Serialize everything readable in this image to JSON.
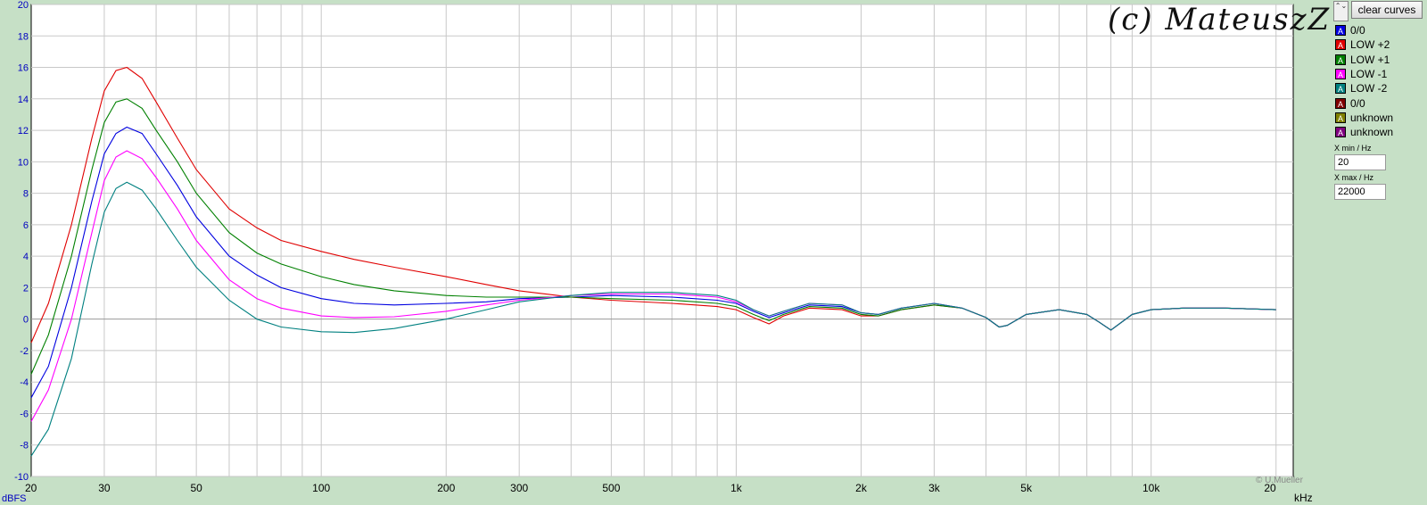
{
  "watermark": "(c) MateuszZ",
  "credit": "© U.Mueller",
  "controls": {
    "clear_label": "clear curves",
    "scroll_glyph": "⌃⌄",
    "xmin_label": "X min / Hz",
    "xmin_value": "20",
    "xmax_label": "X max / Hz",
    "xmax_value": "22000"
  },
  "colors": {
    "background": "#c6e0c6",
    "plot_bg": "#ffffff",
    "grid": "#c8c8c8",
    "axis_text": "#0000c0"
  },
  "chart_data": {
    "type": "line",
    "x_scale": "log",
    "xlim": [
      20,
      22000
    ],
    "ylim": [
      -10,
      20
    ],
    "ylabel_unit": "dBFS",
    "xunit": "kHz",
    "x_ticks": [
      20,
      30,
      50,
      100,
      200,
      300,
      500,
      1000,
      2000,
      3000,
      5000,
      10000,
      20000
    ],
    "x_tick_labels": [
      "20",
      "30",
      "50",
      "100",
      "200",
      "300",
      "500",
      "1k",
      "2k",
      "3k",
      "5k",
      "10k",
      "20"
    ],
    "y_ticks": [
      20,
      18,
      16,
      14,
      12,
      10,
      8,
      6,
      4,
      2,
      0,
      -2,
      -4,
      -6,
      -8,
      -10
    ],
    "y_tick_labels": [
      "20",
      "18",
      "16",
      "14",
      "12",
      "10",
      "8",
      "6",
      "4",
      "2",
      "0",
      "-2",
      "-4",
      "-6",
      "-8",
      "-10"
    ],
    "grid": true,
    "legend": [
      {
        "label": "0/0",
        "color": "#0000e0"
      },
      {
        "label": "LOW +2",
        "color": "#e00000"
      },
      {
        "label": "LOW +1",
        "color": "#008000"
      },
      {
        "label": "LOW -1",
        "color": "#ff00ff"
      },
      {
        "label": "LOW -2",
        "color": "#008080"
      },
      {
        "label": "0/0",
        "color": "#800000"
      },
      {
        "label": "unknown",
        "color": "#808000"
      },
      {
        "label": "unknown",
        "color": "#800080"
      }
    ],
    "series": [
      {
        "name": "0/0",
        "color": "#0000e0",
        "x": [
          20,
          22,
          25,
          28,
          30,
          32,
          34,
          37,
          40,
          45,
          50,
          60,
          70,
          80,
          100,
          120,
          150,
          200,
          250,
          300,
          400,
          500,
          700,
          900,
          1000,
          1100,
          1200,
          1300,
          1500,
          1800,
          2000,
          2200,
          2500,
          3000,
          3500,
          4000,
          4300,
          4500,
          5000,
          6000,
          7000,
          7500,
          8000,
          9000,
          10000,
          12000,
          15000,
          20000
        ],
        "y": [
          -5,
          -3,
          2,
          7.5,
          10.5,
          11.8,
          12.2,
          11.8,
          10.5,
          8.5,
          6.5,
          4,
          2.8,
          2,
          1.3,
          1,
          0.9,
          1,
          1.1,
          1.3,
          1.4,
          1.5,
          1.4,
          1.2,
          1.0,
          0.5,
          0.1,
          0.4,
          0.9,
          0.8,
          0.4,
          0.3,
          0.7,
          1.0,
          0.7,
          0.1,
          -0.5,
          -0.4,
          0.3,
          0.6,
          0.3,
          -0.2,
          -0.7,
          0.3,
          0.6,
          0.7,
          0.7,
          0.6
        ]
      },
      {
        "name": "LOW +2",
        "color": "#e00000",
        "x": [
          20,
          22,
          25,
          28,
          30,
          32,
          34,
          37,
          40,
          45,
          50,
          60,
          70,
          80,
          100,
          120,
          150,
          200,
          250,
          300,
          400,
          500,
          700,
          900,
          1000,
          1100,
          1200,
          1300,
          1500,
          1800,
          2000,
          2200,
          2500,
          3000,
          3500,
          4000,
          4300,
          4500,
          5000,
          6000,
          7000,
          7500,
          8000,
          9000,
          10000,
          12000,
          15000,
          20000
        ],
        "y": [
          -1.5,
          1,
          6,
          11.5,
          14.5,
          15.8,
          16,
          15.3,
          13.8,
          11.5,
          9.5,
          7,
          5.8,
          5,
          4.3,
          3.8,
          3.3,
          2.7,
          2.2,
          1.8,
          1.4,
          1.2,
          1,
          0.8,
          0.6,
          0.1,
          -0.3,
          0.2,
          0.7,
          0.6,
          0.2,
          0.2,
          0.6,
          0.9,
          0.7,
          0.1,
          -0.5,
          -0.4,
          0.3,
          0.6,
          0.3,
          -0.2,
          -0.7,
          0.3,
          0.6,
          0.7,
          0.7,
          0.6
        ]
      },
      {
        "name": "LOW +1",
        "color": "#008000",
        "x": [
          20,
          22,
          25,
          28,
          30,
          32,
          34,
          37,
          40,
          45,
          50,
          60,
          70,
          80,
          100,
          120,
          150,
          200,
          250,
          300,
          400,
          500,
          700,
          900,
          1000,
          1100,
          1200,
          1300,
          1500,
          1800,
          2000,
          2200,
          2500,
          3000,
          3500,
          4000,
          4300,
          4500,
          5000,
          6000,
          7000,
          7500,
          8000,
          9000,
          10000,
          12000,
          15000,
          20000
        ],
        "y": [
          -3.5,
          -1,
          4,
          9.5,
          12.5,
          13.8,
          14,
          13.4,
          12,
          10,
          8,
          5.5,
          4.2,
          3.5,
          2.7,
          2.2,
          1.8,
          1.5,
          1.4,
          1.4,
          1.4,
          1.3,
          1.2,
          1.0,
          0.8,
          0.3,
          -0.1,
          0.3,
          0.8,
          0.7,
          0.3,
          0.2,
          0.6,
          0.9,
          0.7,
          0.1,
          -0.5,
          -0.4,
          0.3,
          0.6,
          0.3,
          -0.2,
          -0.7,
          0.3,
          0.6,
          0.7,
          0.7,
          0.6
        ]
      },
      {
        "name": "LOW -1",
        "color": "#ff00ff",
        "x": [
          20,
          22,
          25,
          28,
          30,
          32,
          34,
          37,
          40,
          45,
          50,
          60,
          70,
          80,
          100,
          120,
          150,
          200,
          250,
          300,
          400,
          500,
          700,
          900,
          1000,
          1100,
          1200,
          1300,
          1500,
          1800,
          2000,
          2200,
          2500,
          3000,
          3500,
          4000,
          4300,
          4500,
          5000,
          6000,
          7000,
          7500,
          8000,
          9000,
          10000,
          12000,
          15000,
          20000
        ],
        "y": [
          -6.5,
          -4.5,
          0,
          5.5,
          8.8,
          10.3,
          10.7,
          10.2,
          9,
          7,
          5,
          2.5,
          1.3,
          0.7,
          0.2,
          0.1,
          0.15,
          0.5,
          0.9,
          1.2,
          1.5,
          1.6,
          1.6,
          1.4,
          1.1,
          0.6,
          0.2,
          0.5,
          1.0,
          0.9,
          0.4,
          0.3,
          0.7,
          1.0,
          0.7,
          0.1,
          -0.5,
          -0.4,
          0.3,
          0.6,
          0.3,
          -0.2,
          -0.7,
          0.3,
          0.6,
          0.7,
          0.7,
          0.6
        ]
      },
      {
        "name": "LOW -2",
        "color": "#008080",
        "x": [
          20,
          22,
          25,
          28,
          30,
          32,
          34,
          37,
          40,
          45,
          50,
          60,
          70,
          80,
          100,
          120,
          150,
          200,
          250,
          300,
          400,
          500,
          700,
          900,
          1000,
          1100,
          1200,
          1300,
          1500,
          1800,
          2000,
          2200,
          2500,
          3000,
          3500,
          4000,
          4300,
          4500,
          5000,
          6000,
          7000,
          7500,
          8000,
          9000,
          10000,
          12000,
          15000,
          20000
        ],
        "y": [
          -8.7,
          -7,
          -2.5,
          3.5,
          6.8,
          8.3,
          8.7,
          8.2,
          7,
          5,
          3.3,
          1.2,
          0,
          -0.5,
          -0.8,
          -0.85,
          -0.6,
          0,
          0.6,
          1.1,
          1.5,
          1.7,
          1.7,
          1.5,
          1.2,
          0.6,
          0.2,
          0.5,
          1.0,
          0.9,
          0.4,
          0.3,
          0.7,
          1.0,
          0.7,
          0.1,
          -0.5,
          -0.4,
          0.3,
          0.6,
          0.3,
          -0.2,
          -0.7,
          0.3,
          0.6,
          0.7,
          0.7,
          0.6
        ]
      }
    ]
  }
}
